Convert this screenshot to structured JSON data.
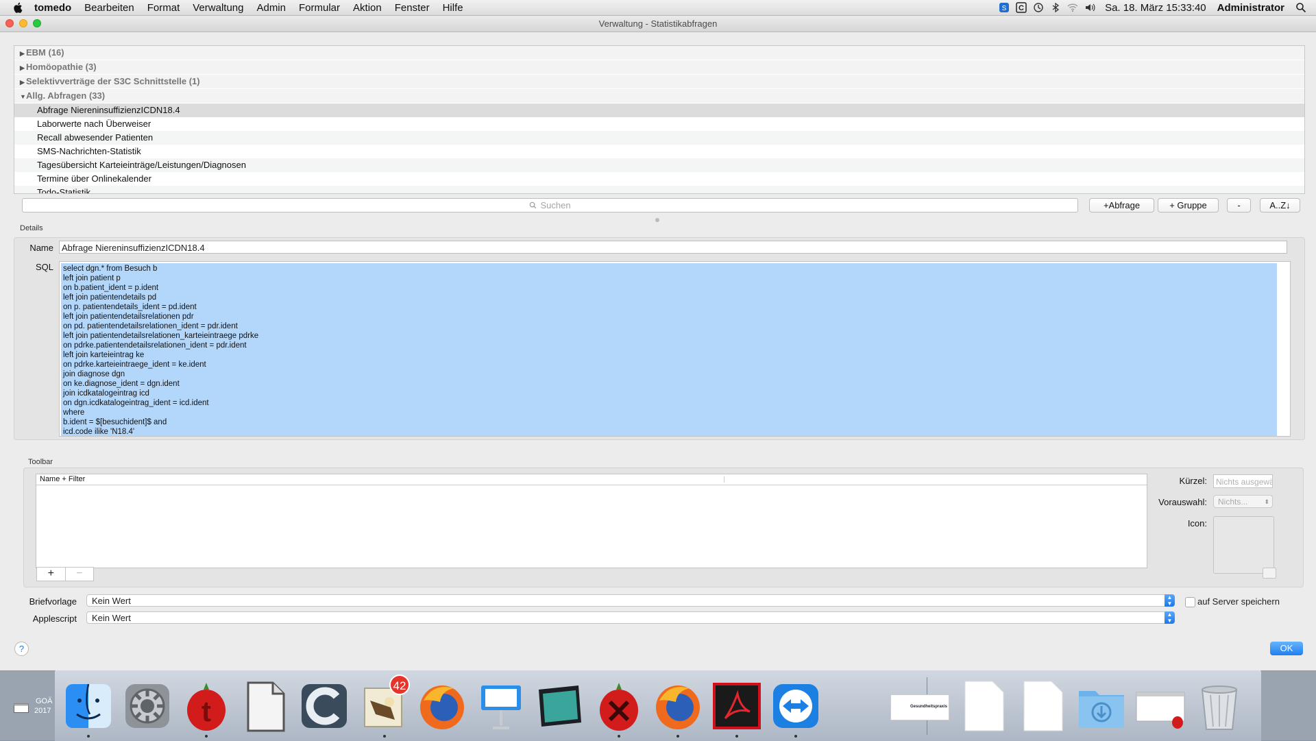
{
  "menubar": {
    "app": "tomedo",
    "items": [
      "Bearbeiten",
      "Format",
      "Verwaltung",
      "Admin",
      "Formular",
      "Aktion",
      "Fenster",
      "Hilfe"
    ],
    "clock": "Sa. 18. März  15:33:40",
    "user": "Administrator",
    "status_icons": [
      "skype-icon",
      "c-app-icon",
      "time-machine-icon",
      "bluetooth-icon",
      "wifi-icon",
      "volume-icon"
    ]
  },
  "window": {
    "title": "Verwaltung - Statistikabfragen"
  },
  "tree": {
    "groups": [
      {
        "label": "EBM (16)",
        "expanded": false
      },
      {
        "label": "Homöopathie (3)",
        "expanded": false
      },
      {
        "label": "Selektivverträge der S3C Schnittstelle (1)",
        "expanded": false
      },
      {
        "label": "Allg. Abfragen (33)",
        "expanded": true
      }
    ],
    "items": [
      "Abfrage NiereninsuffizienzICDN18.4",
      "Laborwerte nach Überweiser",
      "Recall abwesender Patienten",
      "SMS-Nachrichten-Statistik",
      "Tagesübersicht Karteieinträge/Leistungen/Diagnosen",
      "Termine über Onlinekalender",
      "Todo-Statistik"
    ],
    "selected_index": 0
  },
  "search": {
    "placeholder": "Suchen"
  },
  "buttons": {
    "add_query": "+Abfrage",
    "add_group": "+ Gruppe",
    "remove": "-",
    "sort": "A..Z↓"
  },
  "details": {
    "section_label": "Details",
    "name_label": "Name",
    "name_value": "Abfrage NiereninsuffizienzICDN18.4",
    "sql_label": "SQL",
    "sql_lines": [
      "select dgn.* from Besuch b",
      "left join patient p",
      "on b.patient_ident = p.ident",
      "left join patientendetails pd",
      "on p. patientendetails_ident = pd.ident",
      "left join patientendetailsrelationen pdr",
      "on pd. patientendetailsrelationen_ident = pdr.ident",
      "left join patientendetailsrelationen_karteieintraege pdrke",
      "on pdrke.patientendetailsrelationen_ident = pdr.ident",
      "left join karteieintrag ke",
      "on pdrke.karteieintraege_ident = ke.ident",
      "join diagnose dgn",
      "on ke.diagnose_ident = dgn.ident",
      "join icdkatalogeintrag icd",
      "on dgn.icdkatalogeintrag_ident = icd.ident",
      "where",
      "b.ident = $[besuchident]$ and",
      "icd.code ilike 'N18.4'"
    ]
  },
  "toolbar": {
    "section_label": "Toolbar",
    "column_header": "Name + Filter",
    "add": "+",
    "remove": "−",
    "kuerzel_label": "Kürzel:",
    "kuerzel_placeholder": "Nichts ausgewählt",
    "vorauswahl_label": "Vorauswahl:",
    "vorauswahl_value": "Nichts...",
    "icon_label": "Icon:"
  },
  "bottom": {
    "briefvorlage_label": "Briefvorlage",
    "briefvorlage_value": "Kein Wert",
    "applescript_label": "Applescript",
    "applescript_value": "Kein Wert",
    "server_checkbox_label": "auf Server speichern",
    "server_checkbox_checked": false,
    "help": "?",
    "ok": "OK"
  },
  "dock": {
    "badge_mail": "42",
    "desktop_label_1": "GOÄ",
    "desktop_label_2": "2017",
    "praxis_logo_text": "Gesundheitspraxis"
  },
  "colors": {
    "accent": "#1f7ff0",
    "sql_selection": "#b3d6fb",
    "badge": "#e6332b"
  }
}
